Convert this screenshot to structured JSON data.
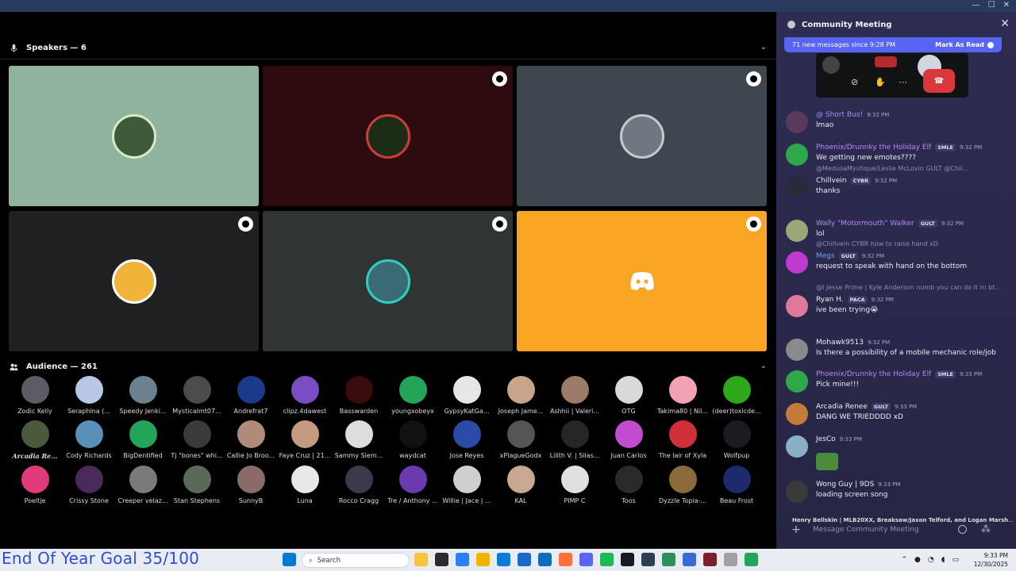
{
  "window": {
    "controls": [
      "—",
      "☐",
      "✕"
    ]
  },
  "speakers": {
    "label": "Speakers — 6"
  },
  "speaker_tiles": [
    {
      "bg": "#8fb39c",
      "avatar": "#3b5b3a",
      "ring": "#d9e8c5",
      "badge": false
    },
    {
      "bg": "#2e0b0f",
      "avatar": "#1c2d16",
      "ring": "#d23b3b",
      "badge": true
    },
    {
      "bg": "#3e4650",
      "avatar": "#6f7780",
      "ring": "#c7c9cc",
      "badge": true
    },
    {
      "bg": "#1f2021",
      "avatar": "#f1b43a",
      "ring": "#ffffff",
      "badge": true
    },
    {
      "bg": "#2f3533",
      "avatar": "#3a6b74",
      "ring": "#2bd0c5",
      "badge": true
    },
    {
      "bg": "#f8a524",
      "avatar": "discord",
      "ring": "",
      "badge": true
    }
  ],
  "audience": {
    "label": "Audience — 261",
    "members": [
      {
        "name": "Zodic Kelly",
        "color": "#5c5c64"
      },
      {
        "name": "Seraphina (...",
        "color": "#b9c7e6"
      },
      {
        "name": "Speedy Jenki...",
        "color": "#6a8290"
      },
      {
        "name": "Mysticalmt07...",
        "color": "#494b4d"
      },
      {
        "name": "Andrefrat7",
        "color": "#1a3a8a"
      },
      {
        "name": "clipz.4dawest",
        "color": "#7b4cc4"
      },
      {
        "name": "Basswarden",
        "color": "#3a0c0c"
      },
      {
        "name": "youngxobeyx",
        "color": "#23a559"
      },
      {
        "name": "GypsyKatGa...",
        "color": "#e6e6e6"
      },
      {
        "name": "Joseph Jame...",
        "color": "#c7a48a"
      },
      {
        "name": "Ashhii | Valeri...",
        "color": "#9c7a6a"
      },
      {
        "name": "OTG",
        "color": "#d9d9d9"
      },
      {
        "name": "Takima80 | Nil...",
        "color": "#f2a3b3"
      },
      {
        "name": "(deer)toxicde...",
        "color": "#2ea81b"
      },
      {
        "name": "Arcadia Re...",
        "color": "#4a5a3a",
        "bold": true
      },
      {
        "name": "Cody Richards",
        "color": "#5a8fb8"
      },
      {
        "name": "BigDentified",
        "color": "#23a559"
      },
      {
        "name": "Tj \"bones\" whi...",
        "color": "#3a3a3a"
      },
      {
        "name": "Callie Jo Broo...",
        "color": "#b08a7a"
      },
      {
        "name": "Faye Cruz | 21...",
        "color": "#c49a80"
      },
      {
        "name": "Sammy Siem...",
        "color": "#dcdcdc"
      },
      {
        "name": "waydcat",
        "color": "#111111"
      },
      {
        "name": "Jose Reyes",
        "color": "#2a4aa8"
      },
      {
        "name": "xPlagueGodx",
        "color": "#555555"
      },
      {
        "name": "Lilith V. | Silas...",
        "color": "#262626"
      },
      {
        "name": "Juan Carlos",
        "color": "#c44ad0"
      },
      {
        "name": "The lair of Xyla",
        "color": "#d0303a"
      },
      {
        "name": "Wolfpup",
        "color": "#1b1b22"
      },
      {
        "name": "Poeltje",
        "color": "#e03a7a"
      },
      {
        "name": "Crissy Stone",
        "color": "#4a2a5a"
      },
      {
        "name": "Creeper velaz...",
        "color": "#7a7a7a"
      },
      {
        "name": "Stan Stephens",
        "color": "#5a6a5a"
      },
      {
        "name": "SunnyB",
        "color": "#8a6a6a"
      },
      {
        "name": "Luna",
        "color": "#e8e8e8"
      },
      {
        "name": "Rocco Cragg",
        "color": "#3a3a4a"
      },
      {
        "name": "Tre / Anthony ...",
        "color": "#6a3ab0"
      },
      {
        "name": "Willie | Jace | ...",
        "color": "#cfcfcf"
      },
      {
        "name": "KAL",
        "color": "#c8a890"
      },
      {
        "name": "PIMP C",
        "color": "#e0e0e0"
      },
      {
        "name": "Toos",
        "color": "#2a2a2a"
      },
      {
        "name": "Dyzzle Topia-...",
        "color": "#8a6a3a"
      },
      {
        "name": "Beau Frost",
        "color": "#1b2a6a"
      }
    ]
  },
  "chat": {
    "title": "Community Meeting",
    "new_messages": "71 new messages since 9:28 PM",
    "mark_read": "Mark As Read",
    "messages": [
      {
        "user": "@ Short Bus!",
        "ucolor": "#b18bf2",
        "tag": "",
        "time": "9:32 PM",
        "text": "lmao",
        "avatar": "#5a3a5a",
        "reply": ""
      },
      {
        "user": "Phoenix/Drunnky the Holiday Elf",
        "ucolor": "#b18bf2",
        "tag": "SMLE",
        "time": "9:32 PM",
        "text": "We getting new emotes????",
        "avatar": "#2ea84a",
        "reply": ""
      },
      {
        "user": "Chillvein",
        "ucolor": "#eceef4",
        "tag": "CYBR",
        "time": "9:32 PM",
        "text": "thanks",
        "avatar": "#2a2a3a",
        "reply": "@MedusaMystique/Leslie McLovin  GULT  @Chil..."
      },
      {
        "user": "Wally \"Motormouth\" Walker",
        "ucolor": "#b18bf2",
        "tag": "GULT",
        "time": "9:32 PM",
        "text": "lol",
        "avatar": "#9aa878",
        "reply": ""
      },
      {
        "user": "Megs",
        "ucolor": "#7a9cff",
        "tag": "GULT",
        "time": "9:32 PM",
        "text": "request to speak with hand on the bottom",
        "avatar": "#c03ad0",
        "reply": "@Chillvein  CYBR  how to raise hand xD"
      },
      {
        "user": "Ryan H.",
        "ucolor": "#eceef4",
        "tag": "PACA",
        "time": "9:32 PM",
        "text": "ive been trying😭",
        "avatar": "#e07a9a",
        "reply": "@I Jesse Prime | Kyle Anderson  numb  you can do it rn bt..."
      },
      {
        "user": "Mohawk9513",
        "ucolor": "#eceef4",
        "tag": "",
        "time": "9:32 PM",
        "text": "Is there a possibility of a mobile mechanic role/job",
        "avatar": "#8a8a8a",
        "reply": ""
      },
      {
        "user": "Phoenix/Drunnky the Holiday Elf",
        "ucolor": "#b18bf2",
        "tag": "SMLE",
        "time": "9:33 PM",
        "text": "Pick mine!!!",
        "avatar": "#2ea84a",
        "reply": ""
      },
      {
        "user": "Arcadia Renee",
        "ucolor": "#eceef4",
        "tag": "GULT",
        "time": "9:33 PM",
        "text": "DANG WE TRIEDDDD xD",
        "avatar": "#c47a3a",
        "reply": ""
      },
      {
        "user": "JesCo",
        "ucolor": "#eceef4",
        "tag": "",
        "time": "9:33 PM",
        "text": "",
        "avatar": "#8ab0c8",
        "reply": ""
      },
      {
        "user": "Wong Guy | 9DS",
        "ucolor": "#eceef4",
        "tag": "",
        "time": "9:33 PM",
        "text": "loading screen song",
        "avatar": "#3a3a3a",
        "reply": ""
      }
    ],
    "typing": "Henry Bellskin | MLB20XX, Breaksaw/Jaxon Telford, and Logan Marshall are...",
    "input_placeholder": "Message Community Meeting"
  },
  "overlay": {
    "goal": "End Of Year Goal 35/100"
  },
  "taskbar": {
    "search": "Search",
    "time": "9:33 PM",
    "date": "12/30/2025",
    "icons": [
      "#0078d4",
      "#f5c542",
      "#2b2b2b",
      "#2d7ff9",
      "#f0b400",
      "#0a7cd8",
      "#1b6ac9",
      "#0f6cbd",
      "#ff7139",
      "#5865f2",
      "#1db954",
      "#171a21",
      "#2c3e50",
      "#2f8f5b",
      "#3b6ad6",
      "#7a1f2b",
      "#a0a0a0",
      "#23a559"
    ]
  }
}
